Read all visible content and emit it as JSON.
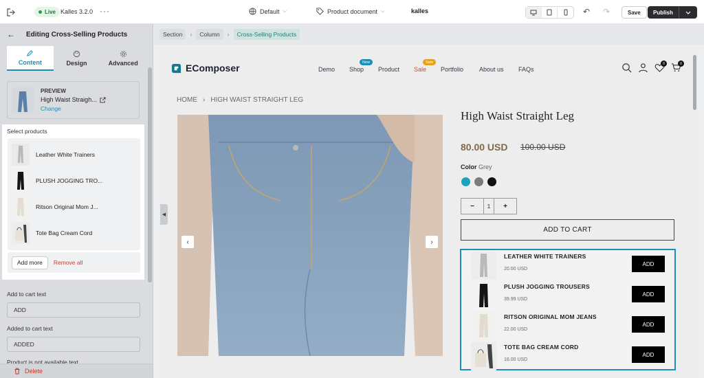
{
  "topbar": {
    "live": "Live",
    "theme": "Kalles 3.2.0",
    "more": "···",
    "template": "Default",
    "page": "Product document",
    "store": "kalles",
    "undo": "↶",
    "redo": "↷",
    "save": "Save",
    "publish": "Publish"
  },
  "panel": {
    "title": "Editing Cross-Selling Products",
    "tabs": [
      {
        "label": "Content",
        "icon": "pencil-icon"
      },
      {
        "label": "Design",
        "icon": "palette-icon"
      },
      {
        "label": "Advanced",
        "icon": "gear-icon"
      }
    ],
    "preview": {
      "heading": "PREVIEW",
      "product": "High Waist Straigh...",
      "change": "Change"
    },
    "select_label": "Select products",
    "products": [
      "Leather White Trainers",
      "PLUSH JOGGING TRO...",
      "Ritson Original Mom J...",
      "Tote Bag Cream Cord"
    ],
    "add_more": "Add more",
    "remove_all": "Remove all",
    "add_to_cart_label": "Add to cart text",
    "add_to_cart_value": "ADD",
    "added_label": "Added to cart text",
    "added_value": "ADDED",
    "unavailable_label": "Product is not available text",
    "delete": "Delete"
  },
  "breadcrumb": [
    "Section",
    "Column",
    "Cross-Selling Products"
  ],
  "store": {
    "logo": "EComposer",
    "nav": [
      {
        "label": "Demo"
      },
      {
        "label": "Shop",
        "badge": "New",
        "badge_color": "#1b8fb4"
      },
      {
        "label": "Product"
      },
      {
        "label": "Sale",
        "badge": "Sale",
        "badge_color": "#e3a21a",
        "color": "#d64b2a"
      },
      {
        "label": "Portfolio"
      },
      {
        "label": "About us"
      },
      {
        "label": "FAQs"
      }
    ],
    "wishlist_count": "0",
    "cart_count": "0",
    "breadcrumb_home": "HOME",
    "breadcrumb_product": "HIGH WAIST STRAIGHT LEG",
    "title": "High Waist Straight Leg",
    "price": "80.00 USD",
    "old_price": "100.00 USD",
    "color_label": "Color",
    "color_value": "Grey",
    "swatches": [
      "#1aa3b9",
      "#7b7b7b",
      "#111111"
    ],
    "qty_minus": "−",
    "qty_value": "1",
    "qty_plus": "+",
    "add_to_cart": "ADD TO CART",
    "cross_sell": [
      {
        "name": "LEATHER WHITE TRAINERS",
        "price": "20.00 USD",
        "button": "ADD"
      },
      {
        "name": "PLUSH JOGGING TROUSERS",
        "price": "39.99 USD",
        "button": "ADD"
      },
      {
        "name": "RITSON ORIGINAL MOM JEANS",
        "price": "22.00 USD",
        "button": "ADD"
      },
      {
        "name": "TOTE BAG CREAM CORD",
        "price": "16.00 USD",
        "button": "ADD"
      }
    ]
  }
}
